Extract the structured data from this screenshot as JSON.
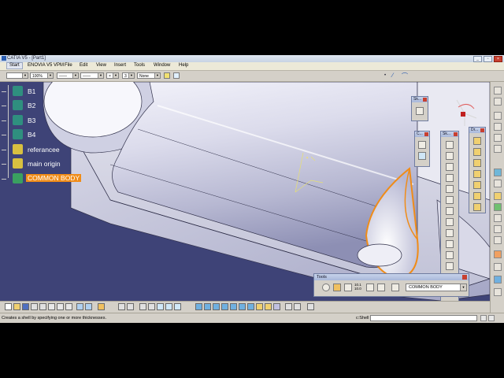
{
  "window": {
    "title": "CATIA V5 - [Part1]"
  },
  "menu": {
    "items": [
      "Start",
      "ENOVIA V5 VPM",
      "File",
      "Edit",
      "View",
      "Insert",
      "Tools",
      "Window",
      "Help"
    ]
  },
  "properties_bar": {
    "layer_value": "",
    "line_type": "",
    "line_weight": "",
    "thickness_value": "3",
    "layer_filter": "None"
  },
  "tree": {
    "items": [
      {
        "label": "B1",
        "selected": false,
        "icon": "body-icon"
      },
      {
        "label": "B2",
        "selected": false,
        "icon": "body-icon"
      },
      {
        "label": "B3",
        "selected": false,
        "icon": "body-icon"
      },
      {
        "label": "B4",
        "selected": false,
        "icon": "body-icon"
      },
      {
        "label": "referancee",
        "selected": false,
        "icon": "geometrical-set-icon"
      },
      {
        "label": "main origin",
        "selected": false,
        "icon": "geometrical-set-icon"
      },
      {
        "label": "COMMON BODY",
        "selected": true,
        "icon": "part-body-icon"
      }
    ]
  },
  "palettes": {
    "sketch_small": {
      "title": "Sk..."
    },
    "constraint": {
      "title": "C..."
    },
    "sketch_tools": {
      "title": "Sk..."
    },
    "dress_up": {
      "title": "Dr..."
    }
  },
  "tools_toolbar": {
    "title": "Tools",
    "scale_top": "10.1",
    "scale_bottom": "10.0",
    "body_selector": "COMMON BODY"
  },
  "status": {
    "message": "Creates a shell by specifying one or more thicknesses.",
    "command_label": "c:Shell",
    "command_value": ""
  },
  "colors": {
    "viewport_background": "#3e4377",
    "selection_highlight": "#f08c18",
    "model_surface": "#dcdcec",
    "tree_icon": "#2f8f7f"
  }
}
